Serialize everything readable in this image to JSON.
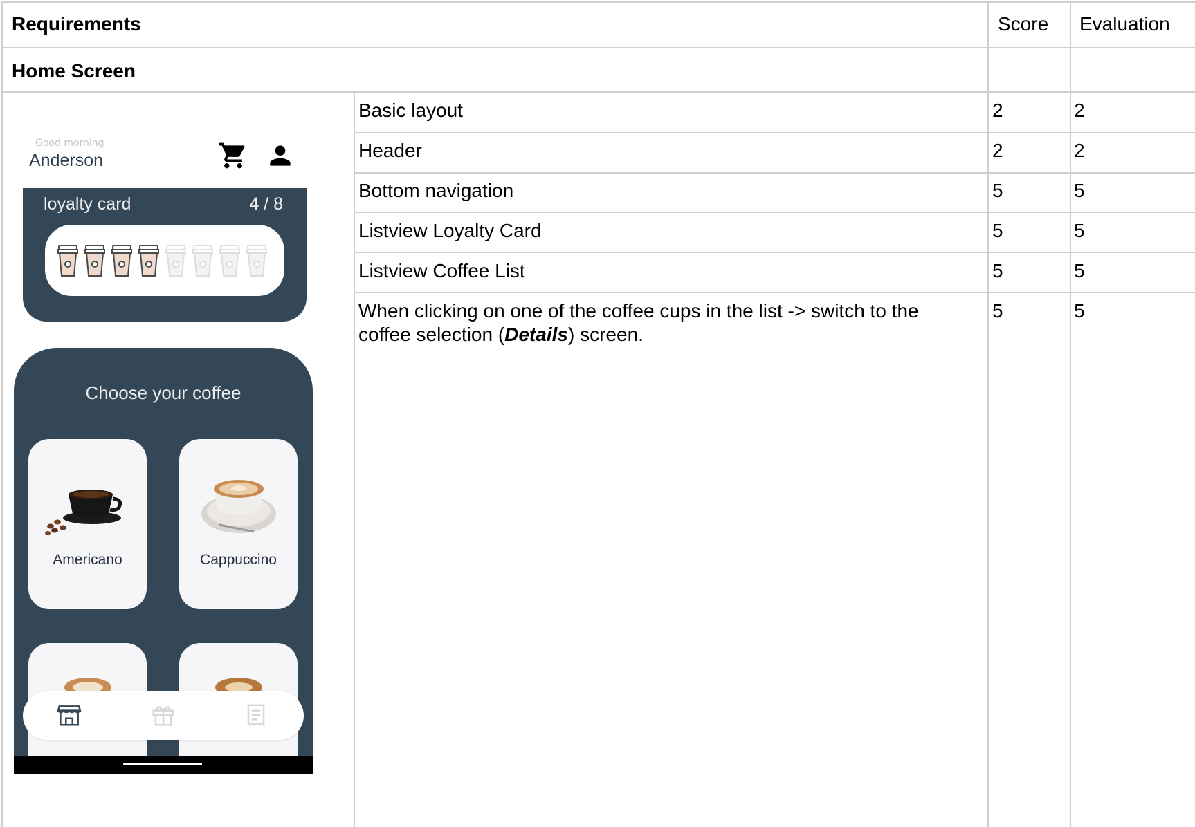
{
  "table": {
    "header": {
      "requirements": "Requirements",
      "score": "Score",
      "evaluation": "Evaluation"
    },
    "section_title": "Home Screen",
    "rows": [
      {
        "requirement": "Basic layout",
        "score": "2",
        "evaluation": "2"
      },
      {
        "requirement": "Header",
        "score": "2",
        "evaluation": "2"
      },
      {
        "requirement": "Bottom navigation",
        "score": "5",
        "evaluation": "5"
      },
      {
        "requirement": "Listview Loyalty Card",
        "score": "5",
        "evaluation": "5"
      },
      {
        "requirement": "Listview Coffee List",
        "score": "5",
        "evaluation": "5"
      },
      {
        "requirement_line1": "When clicking on one of the coffee cups in the list -> switch to the",
        "requirement_line2_pre": "coffee selection (",
        "requirement_line2_bold": "Details",
        "requirement_line2_post": ") screen.",
        "score": "5",
        "evaluation": "5"
      }
    ]
  },
  "phone": {
    "greeting": "Good morning",
    "user_name": "Anderson",
    "header_icons": [
      "cart-icon",
      "person-icon"
    ],
    "loyalty_card": {
      "title": "loyalty card",
      "count": "4 / 8",
      "stamps_filled": 4,
      "stamps_total": 8
    },
    "coffee_section_title": "Choose your coffee",
    "coffees": [
      {
        "name": "Americano"
      },
      {
        "name": "Cappuccino"
      }
    ],
    "bottom_nav": [
      {
        "icon": "store-icon",
        "active": true
      },
      {
        "icon": "gift-icon",
        "active": false
      },
      {
        "icon": "receipt-icon",
        "active": false
      }
    ],
    "colors": {
      "card_bg": "#334756",
      "active_icon": "#334756",
      "inactive_icon": "#d8d8d8"
    }
  }
}
